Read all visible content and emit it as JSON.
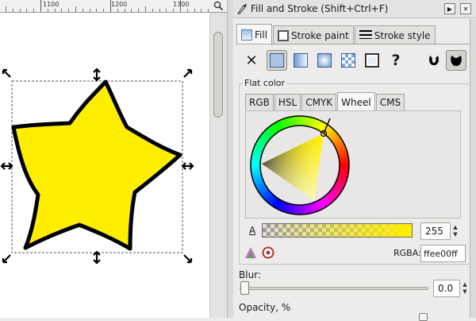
{
  "ruler": {
    "labels": [
      "1100",
      "1200",
      "1300"
    ]
  },
  "zoom_icon": "zoom-magnifier-icon",
  "shape": {
    "fill": "#ffee00",
    "stroke": "#000000"
  },
  "dialog": {
    "title": "Fill and Stroke (Shift+Ctrl+F)",
    "tabs": [
      {
        "label": "Fill",
        "active": true,
        "icon": "fill-swatch-icon"
      },
      {
        "label": "Stroke paint",
        "active": false,
        "icon": "stroke-paint-swatch-icon"
      },
      {
        "label": "Stroke style",
        "active": false,
        "icon": "stroke-style-icon"
      }
    ],
    "paint_buttons": [
      {
        "icon": "no-paint-icon",
        "glyph": "✕",
        "active": false
      },
      {
        "icon": "flat-color-icon",
        "active": true
      },
      {
        "icon": "linear-gradient-icon",
        "active": false
      },
      {
        "icon": "radial-gradient-icon",
        "active": false
      },
      {
        "icon": "pattern-icon",
        "active": false
      },
      {
        "icon": "swatch-icon",
        "active": false
      },
      {
        "icon": "unset-paint-icon",
        "glyph": "?",
        "active": false
      },
      {
        "icon": "fill-rule-evenodd-icon",
        "active": false
      },
      {
        "icon": "fill-rule-nonzero-icon",
        "active": true
      }
    ],
    "flat_color_label": "Flat color",
    "color_tabs": [
      {
        "label": "RGB",
        "active": false
      },
      {
        "label": "HSL",
        "active": false
      },
      {
        "label": "CMYK",
        "active": false
      },
      {
        "label": "Wheel",
        "active": true
      },
      {
        "label": "CMS",
        "active": false
      }
    ],
    "alpha": {
      "key": "A",
      "value": "255"
    },
    "rgba": {
      "label": "RGBA:",
      "value": "ffee00ff",
      "color": "#ffee00"
    },
    "blur": {
      "label": "Blur:",
      "value": "0.0"
    },
    "opacity": {
      "label": "Opacity, %"
    }
  }
}
